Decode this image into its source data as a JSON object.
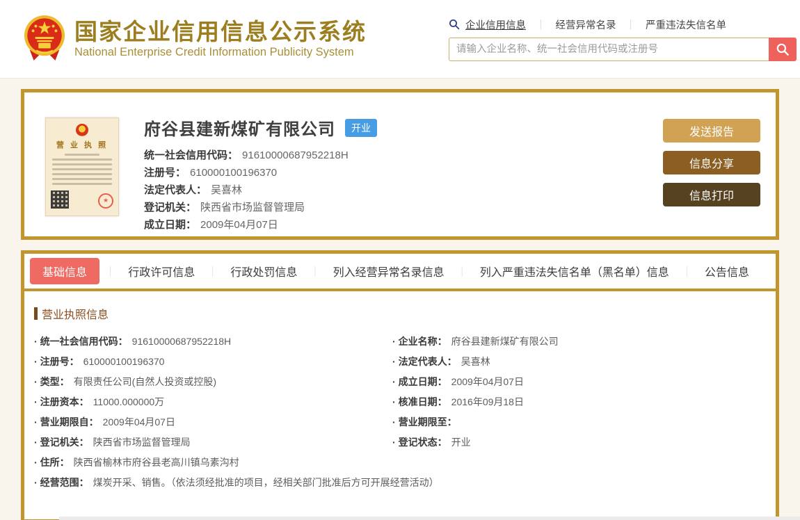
{
  "header": {
    "site_title_zh": "国家企业信用信息公示系统",
    "site_title_en": "National Enterprise Credit Information Publicity System",
    "nav_items": [
      {
        "label": "企业信用信息",
        "active": true
      },
      {
        "label": "经营异常名录",
        "active": false
      },
      {
        "label": "严重违法失信名单",
        "active": false
      }
    ],
    "search_placeholder": "请输入企业名称、统一社会信用代码或注册号"
  },
  "company_card": {
    "name": "府谷县建新煤矿有限公司",
    "status_badge": "开业",
    "license_thumb_title": "营 业 执 照",
    "fields": [
      {
        "label": "统一社会信用代码：",
        "value": "91610000687952218H"
      },
      {
        "label": "注册号：",
        "value": "610000100196370"
      },
      {
        "label": "法定代表人：",
        "value": "吴喜林"
      },
      {
        "label": "登记机关：",
        "value": "陕西省市场监督管理局"
      },
      {
        "label": "成立日期：",
        "value": "2009年04月07日"
      }
    ],
    "buttons": [
      {
        "label": "发送报告"
      },
      {
        "label": "信息分享"
      },
      {
        "label": "信息打印"
      }
    ]
  },
  "tabs": [
    {
      "label": "基础信息",
      "active": true
    },
    {
      "label": "行政许可信息",
      "active": false
    },
    {
      "label": "行政处罚信息",
      "active": false
    },
    {
      "label": "列入经营异常名录信息",
      "active": false
    },
    {
      "label": "列入严重违法失信名单（黑名单）信息",
      "active": false
    },
    {
      "label": "公告信息",
      "active": false
    }
  ],
  "license_section": {
    "title": "营业执照信息",
    "left": [
      {
        "label": "统一社会信用代码：",
        "value": "91610000687952218H"
      },
      {
        "label": "注册号：",
        "value": "610000100196370"
      },
      {
        "label": "类型：",
        "value": "有限责任公司(自然人投资或控股)"
      },
      {
        "label": "注册资本：",
        "value": "11000.000000万"
      },
      {
        "label": "营业期限自：",
        "value": "2009年04月07日"
      },
      {
        "label": "登记机关：",
        "value": "陕西省市场监督管理局"
      }
    ],
    "right": [
      {
        "label": "企业名称：",
        "value": "府谷县建新煤矿有限公司"
      },
      {
        "label": "法定代表人：",
        "value": "吴喜林"
      },
      {
        "label": "成立日期：",
        "value": "2009年04月07日"
      },
      {
        "label": "核准日期：",
        "value": "2016年09月18日"
      },
      {
        "label": "营业期限至：",
        "value": ""
      },
      {
        "label": "登记状态：",
        "value": "开业"
      }
    ],
    "full": [
      {
        "label": "住所：",
        "value": "陕西省榆林市府谷县老高川镇乌素沟村"
      },
      {
        "label": "经营范围：",
        "value": "煤炭开采、销售。（依法须经批准的项目，经相关部门批准后方可开展经营活动）"
      }
    ]
  },
  "colors": {
    "gold_title": "#9c7e1f",
    "gold_border": "#c3952f",
    "cream_background": "#faf5ec",
    "active_tab_red": "#ee6a62",
    "search_button_red": "#ef625c",
    "status_badge_blue": "#469de4",
    "section_heading_brown": "#8b4e20",
    "button_send_report": "#d2a253",
    "button_share": "#8c5e22",
    "button_print": "#564120"
  }
}
